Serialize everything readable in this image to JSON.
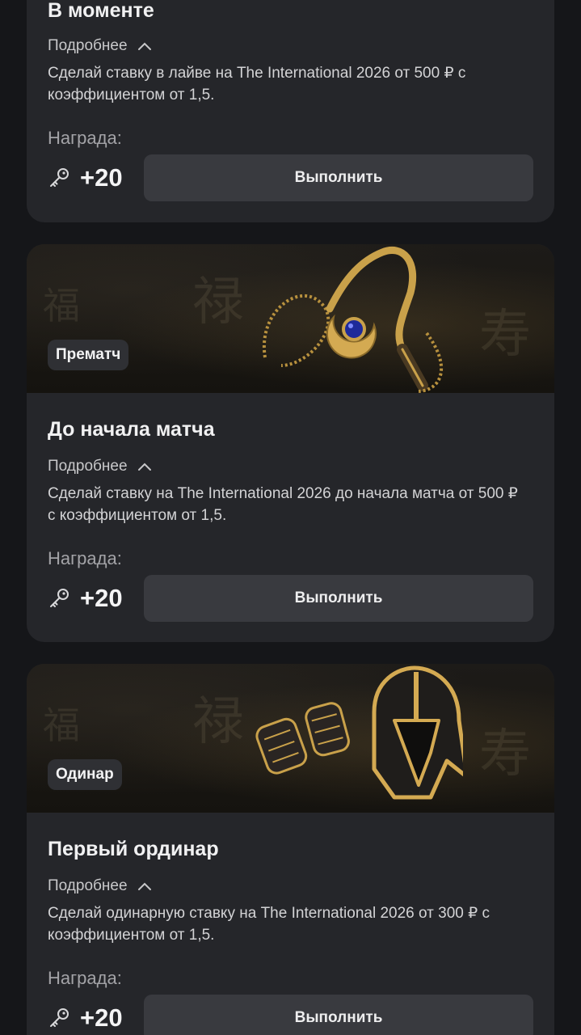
{
  "tasks": [
    {
      "tag": "",
      "title": "В моменте",
      "more_label": "Подробнее",
      "description": "Сделай ставку в лайве на The International 2026 от 500 ₽ с коэффициентом от 1,5.",
      "reward_label": "Награда:",
      "reward_value": "+20",
      "button_label": "Выполнить"
    },
    {
      "tag": "Прематч",
      "title": "До начала матча",
      "more_label": "Подробнее",
      "description": "Сделай ставку на The International 2026 до начала матча от 500 ₽ с коэффициентом от 1,5.",
      "reward_label": "Награда:",
      "reward_value": "+20",
      "button_label": "Выполнить"
    },
    {
      "tag": "Одинар",
      "title": "Первый ординар",
      "more_label": "Подробнее",
      "description": "Сделай одинарную ставку на The International 2026 от 300 ₽ с коэффициентом от 1,5.",
      "reward_label": "Награда:",
      "reward_value": "+20",
      "button_label": "Выполнить"
    }
  ],
  "icons": {
    "reward": "key-icon",
    "expand": "chevron-up-icon",
    "banner_2": "amulet-illustration",
    "banner_3": "helmet-gauntlets-illustration"
  },
  "colors": {
    "background": "#151619",
    "card": "#25262a",
    "button": "#393a3f",
    "accent_gold": "#c9a14a"
  }
}
